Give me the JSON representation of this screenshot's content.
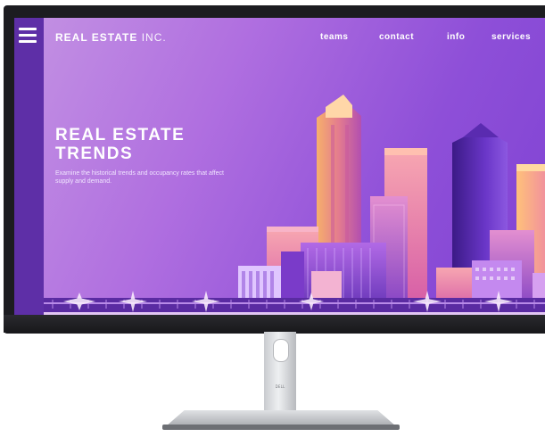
{
  "site": {
    "brand_bold": "REAL ESTATE",
    "brand_light": "INC.",
    "nav": {
      "teams": "teams",
      "contact": "contact",
      "info": "info",
      "services": "services"
    },
    "hero": {
      "title_line1": "REAL ESTATE",
      "title_line2": "TRENDS",
      "subtitle": "Examine the historical trends and occupancy rates that affect supply and demand."
    }
  },
  "monitor": {
    "stand_logo": "DELL"
  },
  "icons": {
    "menu": "hamburger-menu-icon"
  },
  "colors": {
    "rail": "#5e2fa7",
    "sky_light": "#c493e3",
    "sky_dark": "#7f42d3",
    "bezel": "#1c1c20",
    "stand": "#d8dadd"
  }
}
